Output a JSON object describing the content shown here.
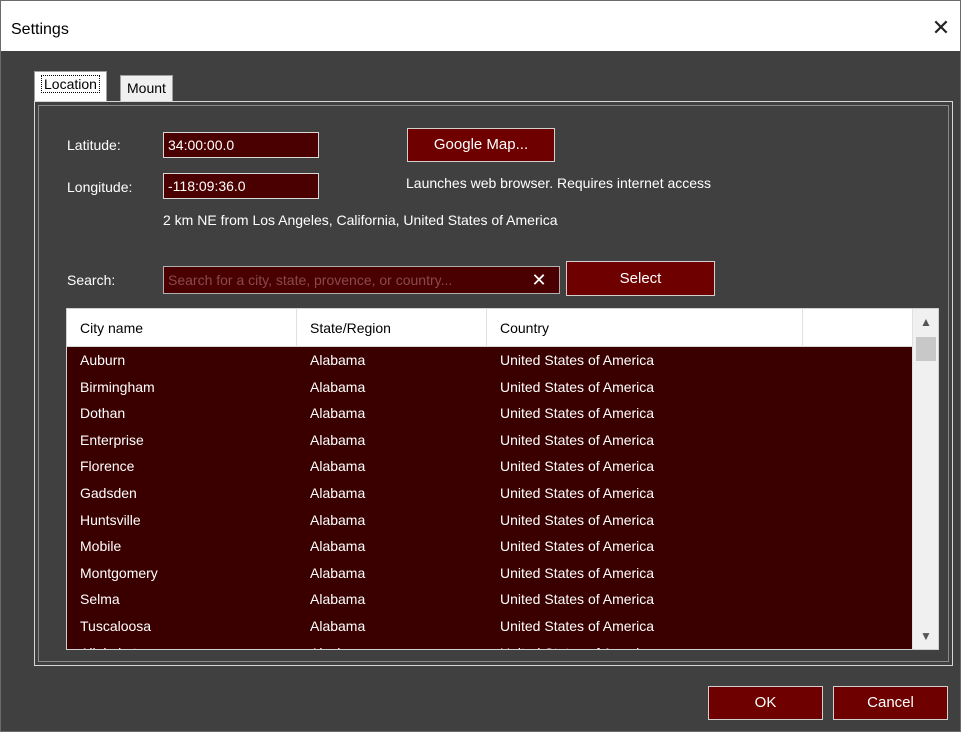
{
  "window": {
    "title": "Settings"
  },
  "tabs": [
    {
      "label": "Location"
    },
    {
      "label": "Mount"
    }
  ],
  "location": {
    "latitude_label": "Latitude:",
    "latitude_value": "34:00:00.0",
    "longitude_label": "Longitude:",
    "longitude_value": "-118:09:36.0",
    "google_map_button": "Google Map...",
    "browser_note": "Launches web browser. Requires internet access",
    "nearby_text": "2 km NE from Los Angeles, California, United States of America",
    "search_label": "Search:",
    "search_placeholder": "Search for a city, state, provence, or country...",
    "clear_symbol": "✕",
    "select_button": "Select"
  },
  "table": {
    "columns": [
      "City name",
      "State/Region",
      "Country"
    ],
    "rows": [
      [
        "Auburn",
        "Alabama",
        "United States of America"
      ],
      [
        "Birmingham",
        "Alabama",
        "United States of America"
      ],
      [
        "Dothan",
        "Alabama",
        "United States of America"
      ],
      [
        "Enterprise",
        "Alabama",
        "United States of America"
      ],
      [
        "Florence",
        "Alabama",
        "United States of America"
      ],
      [
        "Gadsden",
        "Alabama",
        "United States of America"
      ],
      [
        "Huntsville",
        "Alabama",
        "United States of America"
      ],
      [
        "Mobile",
        "Alabama",
        "United States of America"
      ],
      [
        "Montgomery",
        "Alabama",
        "United States of America"
      ],
      [
        "Selma",
        "Alabama",
        "United States of America"
      ],
      [
        "Tuscaloosa",
        "Alabama",
        "United States of America"
      ],
      [
        "Allakaket",
        "Alaska",
        "United States of America"
      ]
    ]
  },
  "footer": {
    "ok_button": "OK",
    "cancel_button": "Cancel"
  },
  "icons": {
    "close": "close-icon",
    "scroll_up": "chevron-up-icon",
    "scroll_down": "chevron-down-icon"
  },
  "colors": {
    "field_bg": "#4a0000",
    "button_bg": "#6e0000",
    "table_bg": "#3a0000",
    "panel_bg": "#404040"
  }
}
